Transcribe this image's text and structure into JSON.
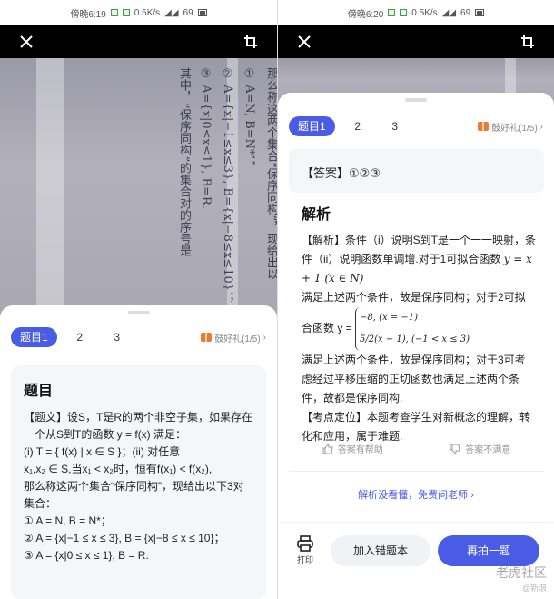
{
  "left": {
    "status": {
      "time": "傍晚6:19",
      "speed": "0.5K/s",
      "battery": "69"
    },
    "tabs": [
      {
        "label": "题目1"
      },
      {
        "label": "2"
      },
      {
        "label": "3"
      }
    ],
    "promo": "鼓好礼(1/5)",
    "card_title": "题目",
    "question_lines": [
      "【题文】设S，T是R的两个非空子集，如果存在一个从S到T的函数 y = f(x) 满足：",
      "(i) T = { f(x) | x ∈ S }；(ii) 对任意",
      "x₁,x₂ ∈ S,当x₁ < x₂时，恒有f(x₁) < f(x₂),",
      "那么称这两个集合“保序同构”，现给出以下3对集合：",
      "① A = N, B = N*；",
      "② A = {x|−1 ≤ x ≤ 3}, B = {x|−8 ≤ x ≤ 10}；",
      "③ A = {x|0 ≤ x ≤ 1}, B = R."
    ],
    "photo_text": [
      "设S，T是R的两个非空子集，如果存在一个从S",
      "(i) T={f(x)|x∈S}；(ii) 对任意x₁,x₂∈S，",
      "那么称这两个集合“保序同构”，现给出以",
      "① A=N, B=N*；",
      "② A={x|−1≤x≤3}, B={x|−8≤x≤10}；",
      "③ A={x|0≤x≤1}, B=R.",
      "其中，“保序同构”的集合对的序号是"
    ]
  },
  "right": {
    "status": {
      "time": "傍晚6:20",
      "speed": "0.5K/s",
      "battery": "69"
    },
    "tabs": [
      {
        "label": "题目1"
      },
      {
        "label": "2"
      },
      {
        "label": "3"
      }
    ],
    "promo": "鼓好礼(1/5)",
    "answer": "【答案】①②③",
    "analysis_title": "解析",
    "analysis_line1": "【解析】条件（i）说明S到T是一个一一映射，条件（ii）说明函数单调增.对于1可拟合函数",
    "analysis_formula1": "y = x + 1 (x ∈ N)",
    "analysis_line2": "满足上述两个条件，故是保序同构；对于2可拟合函数 y =",
    "piece1": "−8, (x = −1)",
    "piece2": "5/2(x − 1), (−1 < x ≤ 3)",
    "analysis_line3": "满足上述两个条件，故是保序同构；对于3可考虑经过平移压缩的正切函数也满足上述两个条件，故都是保序同构.",
    "analysis_line4": "【考点定位】本题考查学生对新概念的理解，转化和应用，属于难题.",
    "helpful": "答案有帮助",
    "not_helpful": "答案不满意",
    "ask_teacher": "解析没看懂，免费问老师 ›",
    "print": "打印",
    "add_mistake": "加入错题本",
    "retake": "再拍一题",
    "watermark": "老虎社区",
    "watermark_sub": "@新浪"
  }
}
